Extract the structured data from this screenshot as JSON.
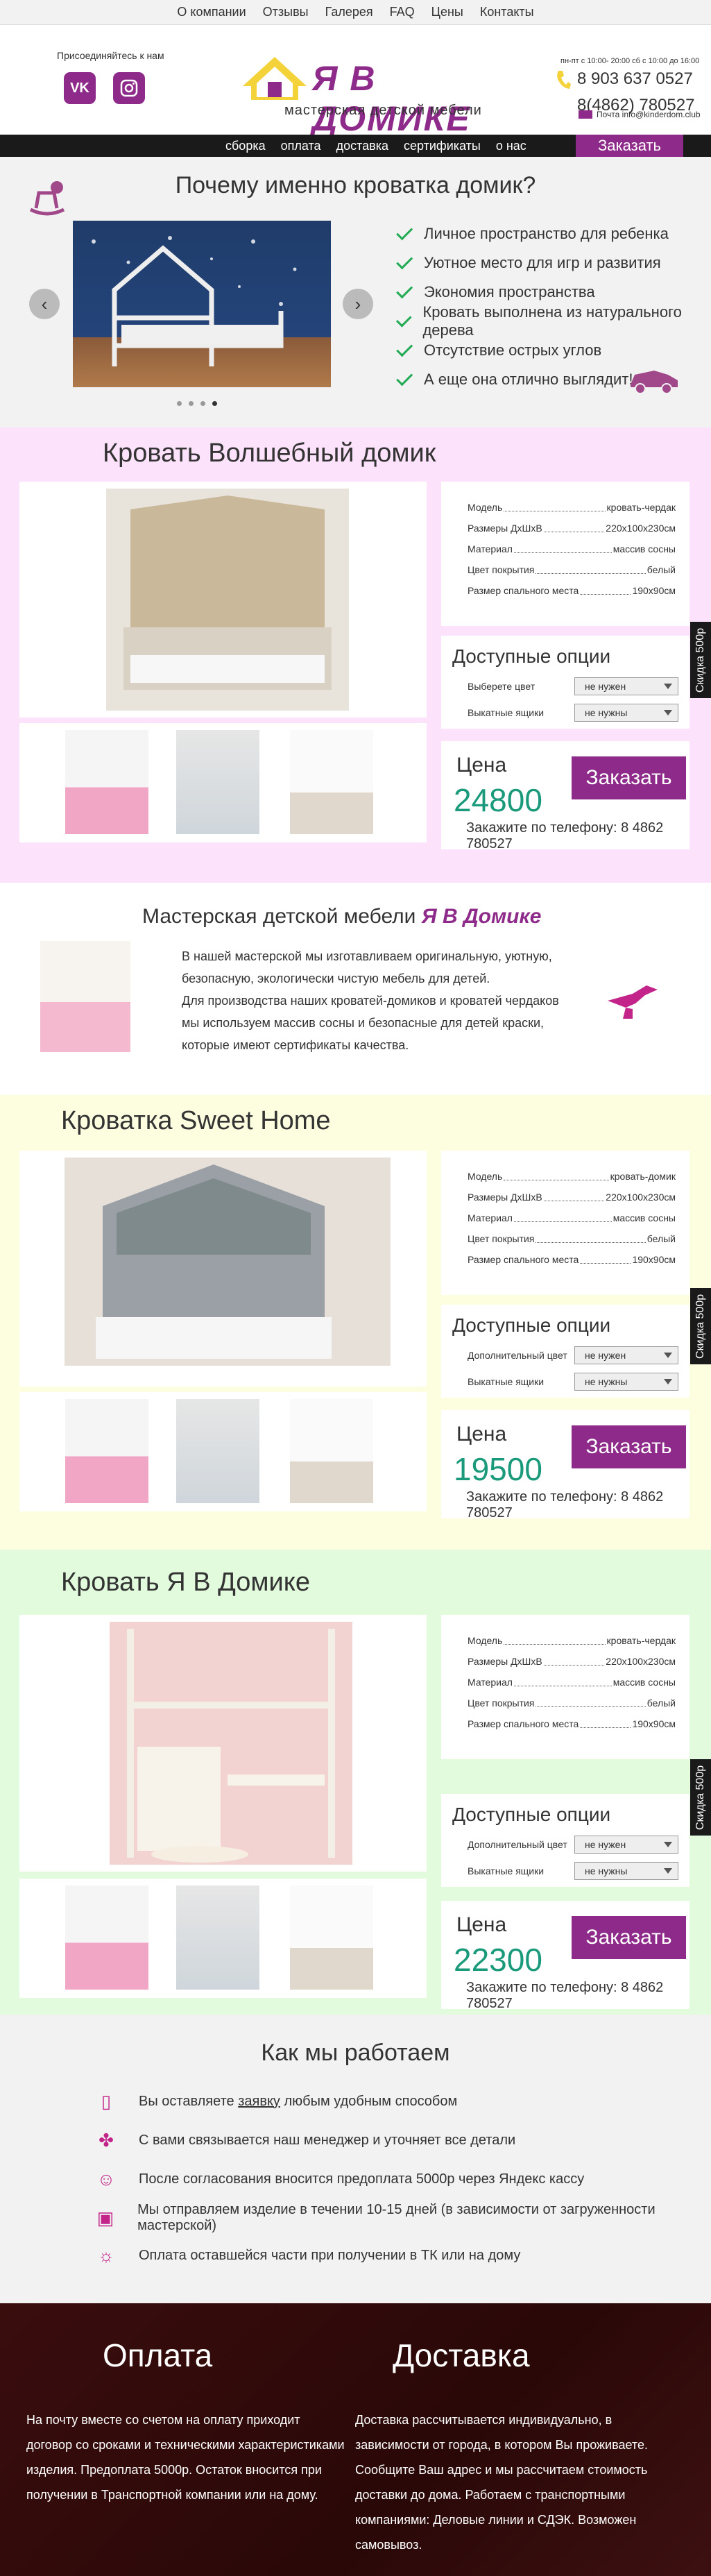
{
  "topmenu": [
    "О компании",
    "Отзывы",
    "Галерея",
    "FAQ",
    "Цены",
    "Контакты"
  ],
  "header": {
    "social_label": "Присоединяйтесь к нам",
    "vk": "VK",
    "logo_title": "Я В ДОМИКЕ",
    "logo_sub": "мастерская детской мебели",
    "hours": "пн-пт с 10:00- 20:00 сб с 10:00 до 16:00",
    "phone1": "8 903 637 0527",
    "phone2": "8(4862) 780527",
    "mail": "Почта info@kinderdom.club"
  },
  "nav": {
    "items": [
      "сборка",
      "оплата",
      "доставка",
      "сертификаты",
      "о нас"
    ],
    "order": "Заказать"
  },
  "why": {
    "title": "Почему именно кроватка домик?",
    "features": [
      "Личное пространство для ребенка",
      "Уютное место для игр и развития",
      "Экономия пространства",
      "Кровать выполнена из натурального дерева",
      "Отсутствие острых углов",
      "А еще она отлично выглядит!"
    ]
  },
  "products": [
    {
      "title": "Кровать Волшебный домик",
      "specs": [
        [
          "Модель",
          "кровать-чердак"
        ],
        [
          "Размеры ДхШхВ",
          "220x100x230см"
        ],
        [
          "Материал",
          "массив сосны"
        ],
        [
          "Цвет покрытия",
          "белый"
        ],
        [
          "Размер спального места",
          "190x90см"
        ]
      ],
      "options_title": "Доступные опции",
      "opt1": "Выберете цвет",
      "opt2": "Выкатные ящики",
      "sel1": "не нужен",
      "sel2": "не нужны",
      "price_label": "Цена",
      "price": "24800",
      "order": "Заказать",
      "tel": "Закажите по телефону: 8 4862 780527",
      "side": "Скидка 500р"
    },
    {
      "title": "Кроватка Sweet Home",
      "specs": [
        [
          "Модель",
          "кровать-домик"
        ],
        [
          "Размеры ДхШхВ",
          "220x100x230см"
        ],
        [
          "Материал",
          "массив сосны"
        ],
        [
          "Цвет покрытия",
          "белый"
        ],
        [
          "Размер спального места",
          "190x90см"
        ]
      ],
      "options_title": "Доступные опции",
      "opt1": "Дополнительный цвет",
      "opt2": "Выкатные ящики",
      "sel1": "не нужен",
      "sel2": "не нужны",
      "price_label": "Цена",
      "price": "19500",
      "order": "Заказать",
      "tel": "Закажите по телефону: 8 4862 780527",
      "side": "Скидка 500р"
    },
    {
      "title": "Кровать Я В Домике",
      "specs": [
        [
          "Модель",
          "кровать-чердак"
        ],
        [
          "Размеры ДхШхВ",
          "220x100x230см"
        ],
        [
          "Материал",
          "массив сосны"
        ],
        [
          "Цвет покрытия",
          "белый"
        ],
        [
          "Размер спального места",
          "190x90см"
        ]
      ],
      "options_title": "Доступные опции",
      "opt1": "Дополнительный цвет",
      "opt2": "Выкатные ящики",
      "sel1": "не нужен",
      "sel2": "не нужны",
      "price_label": "Цена",
      "price": "22300",
      "order": "Заказать",
      "tel": "Закажите по телефону: 8 4862 780527",
      "side": "Скидка 500р"
    }
  ],
  "about": {
    "title_pre": "Мастерская детской мебели ",
    "brand": "Я В Домике",
    "p1": "В нашей мастерской мы изготавливаем оригинальную, уютную, безопасную, экологически чистую мебель для детей.",
    "p2": "Для производства наших кроватей-домиков и кроватей чердаков мы используем массив сосны и безопасные для детей краски, которые имеют сертификаты качества."
  },
  "how": {
    "title": "Как мы работаем",
    "step1_pre": "Вы оставляете ",
    "step1_link": "заявку",
    "step1_post": " любым удобным способом",
    "steps": [
      "С вами связывается наш менеджер и уточняет все детали",
      "После согласования вносится предоплата 5000р через Яндекс кассу",
      "Мы отправляем изделие в течении 10-15 дней (в зависимости от загруженности мастерской)",
      "Оплата оставшейся части при получении в ТК или на дому"
    ]
  },
  "footer": {
    "pay_title": "Оплата",
    "pay_text": "На почту вместе со счетом на оплату приходит договор со сроками и техническими характеристиками изделия. Предоплата 5000р. Остаток вносится при получении в Транспортной компании или на дому.",
    "del_title": "Доставка",
    "del_text": "Доставка рассчитывается индивидуально, в зависимости от города, в котором Вы проживаете. Сообщите Ваш адрес и мы рассчитаем стоимость доставки до дома. Работаем с транспортными компаниями: Деловые линии и СДЭК. Возможен самовывоз."
  },
  "colors": {
    "brand": "#8e2a8a",
    "price": "#1a9a7a",
    "pink_bg": "#fde2fb",
    "yellow_bg": "#fdfde0",
    "green_bg": "#e2fbdd"
  }
}
